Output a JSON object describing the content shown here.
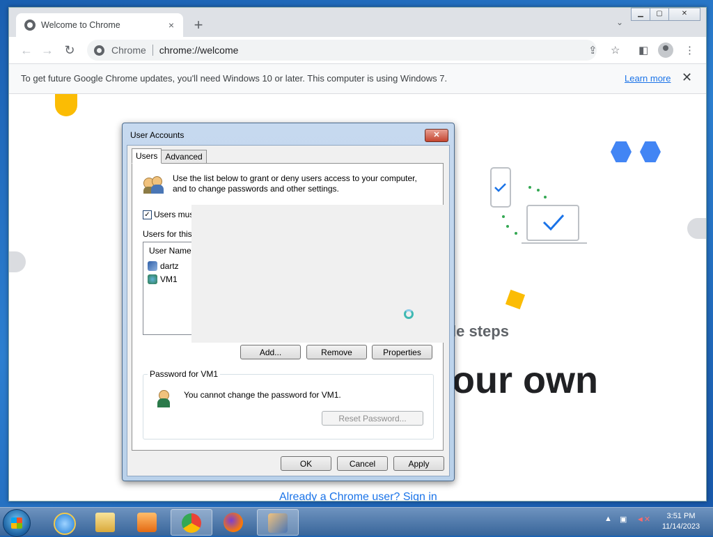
{
  "browser": {
    "tab_title": "Welcome to Chrome",
    "tab_close": "×",
    "new_tab": "+",
    "tab_search": "⌄",
    "omnibox_chip": "Chrome",
    "omnibox_url": "chrome://welcome",
    "infobar_message": "To get future Google Chrome updates, you'll need Windows 10 or later. This computer is using Windows 7.",
    "infobar_link": "Learn more",
    "infobar_close": "✕"
  },
  "page": {
    "steps_text": "le steps",
    "headline_text": "our own",
    "signin_link": "Already a Chrome user? Sign in"
  },
  "dialog": {
    "title": "User Accounts",
    "close": "✕",
    "tabs": [
      "Users",
      "Advanced"
    ],
    "intro": "Use the list below to grant or deny users access to your computer, and to change passwords and other settings.",
    "checkbox_checked": true,
    "checkbox_label": "Users mus",
    "users_label": "Users for this",
    "list_header": "User Name",
    "users": [
      "dartz",
      "VM1"
    ],
    "buttons": {
      "add": "Add...",
      "remove": "Remove",
      "properties": "Properties"
    },
    "password_group_title": "Password for VM1",
    "password_message": "You cannot change the password for VM1.",
    "reset_button": "Reset Password...",
    "ok": "OK",
    "cancel": "Cancel",
    "apply": "Apply"
  },
  "taskbar": {
    "time": "3:51 PM",
    "date": "11/14/2023",
    "tray": "▲"
  },
  "colors": {
    "accent": "#1a73e8",
    "chrome_blue": "#4285f4",
    "chrome_yellow": "#fbbc04"
  }
}
